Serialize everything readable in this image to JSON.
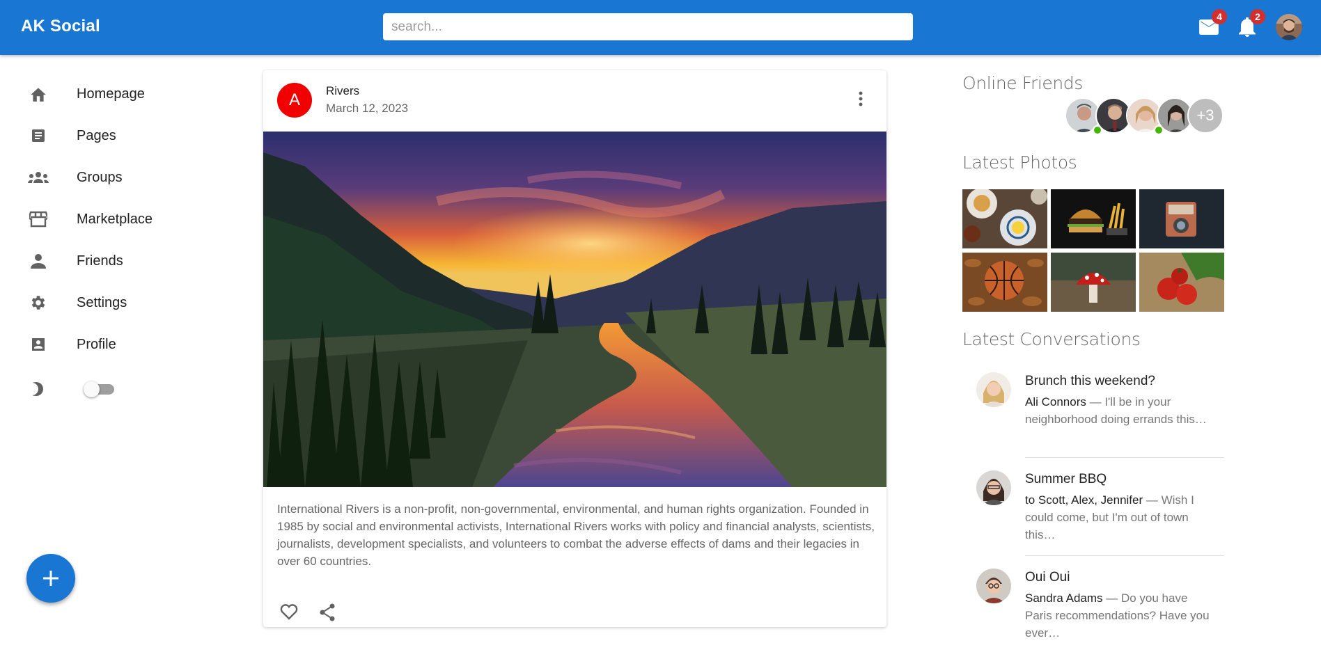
{
  "app": {
    "title": "AK Social"
  },
  "search": {
    "placeholder": "search..."
  },
  "topbar": {
    "mail_badge": "4",
    "notifications_badge": "2",
    "accent": "#1976d2",
    "badge_color": "#d32f2f"
  },
  "nav": {
    "items": [
      {
        "label": "Homepage",
        "icon": "home-icon"
      },
      {
        "label": "Pages",
        "icon": "article-icon"
      },
      {
        "label": "Groups",
        "icon": "groups-icon"
      },
      {
        "label": "Marketplace",
        "icon": "storefront-icon"
      },
      {
        "label": "Friends",
        "icon": "person-icon"
      },
      {
        "label": "Settings",
        "icon": "gear-icon"
      },
      {
        "label": "Profile",
        "icon": "account-box-icon"
      }
    ],
    "dark_mode_icon": "moon-icon",
    "dark_mode_on": false
  },
  "post": {
    "avatar_letter": "A",
    "author": "Rivers",
    "date": "March 12, 2023",
    "text": "International Rivers is a non-profit, non-governmental, environmental, and human rights organization. Founded in 1985 by social and environmental activists, International Rivers works with policy and financial analysts, scientists, journalists, development specialists, and volunteers to combat the adverse effects of dams and their legacies in over 60 countries.",
    "image": "sunset-river-valley",
    "avatar_color": "#f10000"
  },
  "right": {
    "online_title": "Online Friends",
    "more_friends": "+3",
    "photos_title": "Latest Photos",
    "photos": [
      "breakfast",
      "burger-and-fries",
      "vintage-camera",
      "basketball-in-leaves",
      "red-mushroom",
      "tomatoes-on-burlap"
    ],
    "conversations_title": "Latest Conversations",
    "conversations": [
      {
        "title": "Brunch this weekend?",
        "who": "Ali Connors",
        "text": " — I'll be in your neighborhood doing errands this…"
      },
      {
        "title": "Summer BBQ",
        "who": "to Scott, Alex, Jennifer",
        "text": " — Wish I could come, but I'm out of town this…"
      },
      {
        "title": "Oui Oui",
        "who": "Sandra Adams",
        "text": " — Do you have Paris recommendations? Have you ever…"
      }
    ]
  }
}
